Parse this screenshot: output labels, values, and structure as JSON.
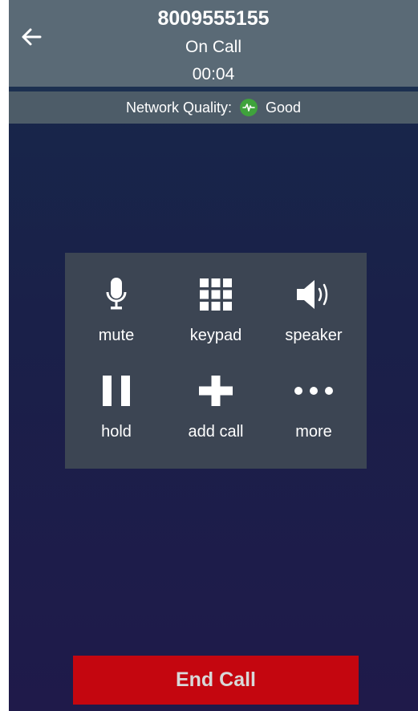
{
  "header": {
    "title": "8009555155",
    "status": "On Call",
    "timer": "00:04"
  },
  "network": {
    "label": "Network Quality:",
    "value": "Good",
    "status_color": "#3fa33c"
  },
  "controls": [
    {
      "id": "mute",
      "label": "mute",
      "icon": "microphone-icon"
    },
    {
      "id": "keypad",
      "label": "keypad",
      "icon": "keypad-icon"
    },
    {
      "id": "speaker",
      "label": "speaker",
      "icon": "speaker-icon"
    },
    {
      "id": "hold",
      "label": "hold",
      "icon": "pause-icon"
    },
    {
      "id": "add_call",
      "label": "add call",
      "icon": "plus-icon"
    },
    {
      "id": "more",
      "label": "more",
      "icon": "more-icon"
    }
  ],
  "end_call": {
    "label": "End Call",
    "color": "#c4060f"
  },
  "colors": {
    "header_bg": "#5a6a76",
    "network_bg": "#4d5c68",
    "panel_bg": "#3c4553",
    "background_top": "#16294a",
    "background_bottom": "#1f1a4a"
  }
}
